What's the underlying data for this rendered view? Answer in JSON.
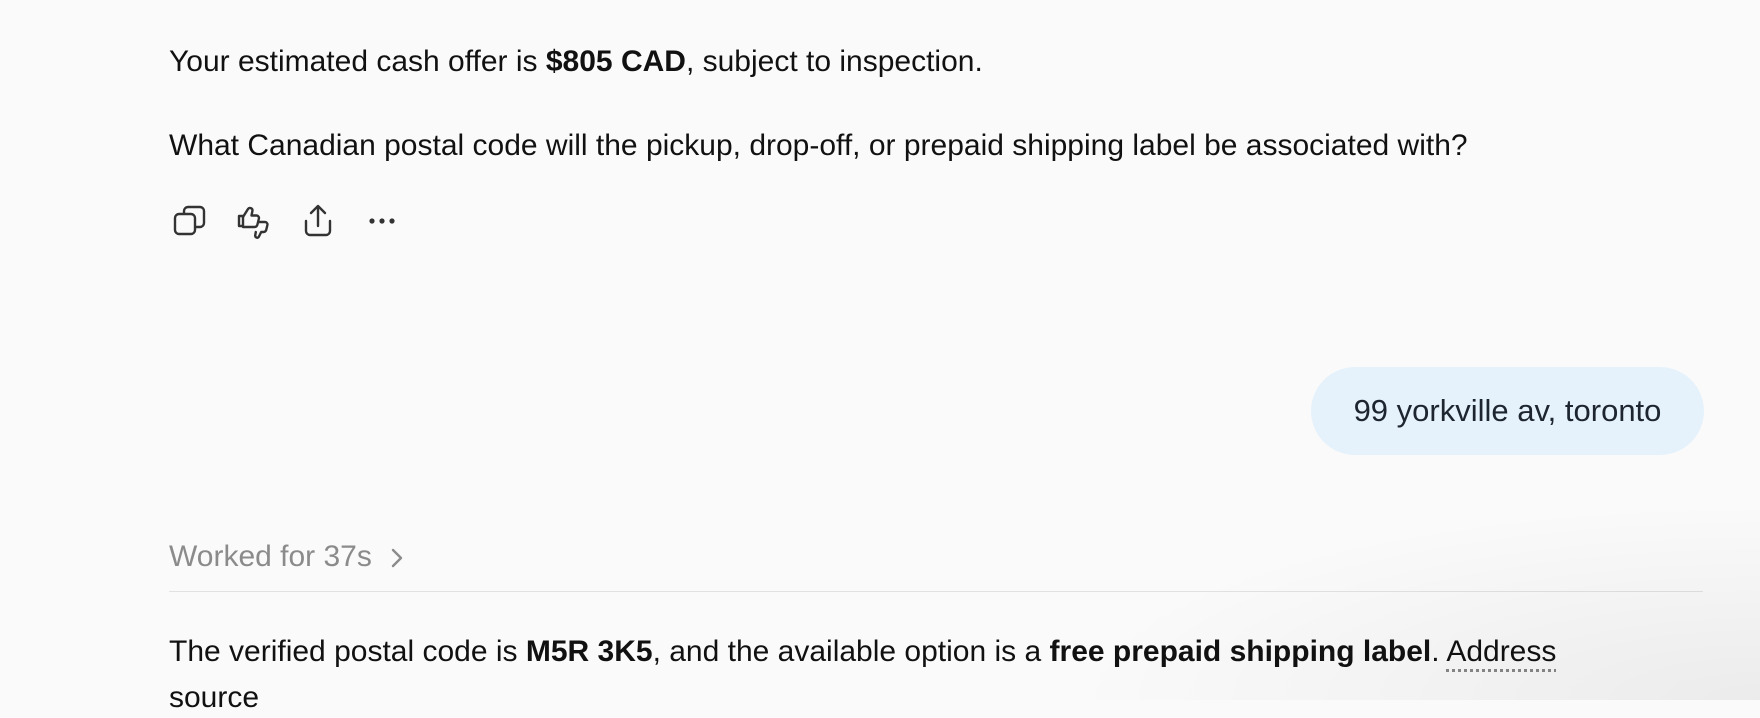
{
  "messages": {
    "assistant_1": {
      "offer_prefix": "Your estimated cash offer is ",
      "offer_amount": "$805 CAD",
      "offer_suffix": ", subject to inspection.",
      "question": "What Canadian postal code will the pickup, drop-off, or prepaid shipping label be associated with?"
    },
    "actions": [
      {
        "name": "copy",
        "icon": "copy-icon"
      },
      {
        "name": "feedback",
        "icon": "thumbs-up-down-icon"
      },
      {
        "name": "share",
        "icon": "share-icon"
      },
      {
        "name": "more",
        "icon": "more-icon"
      }
    ],
    "user_1": {
      "text": "99 yorkville av, toronto"
    },
    "worked": {
      "label": "Worked for 37s"
    },
    "assistant_2": {
      "prefix": "The verified postal code is ",
      "postal_code": "M5R 3K5",
      "middle": ", and the available option is a ",
      "option": "free prepaid shipping label",
      "period": ".",
      "link_text": "Address",
      "overflow_text": "source"
    }
  },
  "colors": {
    "background": "#fafafa",
    "user_bubble": "#e6f2fb",
    "muted_text": "#8b8b8b"
  }
}
